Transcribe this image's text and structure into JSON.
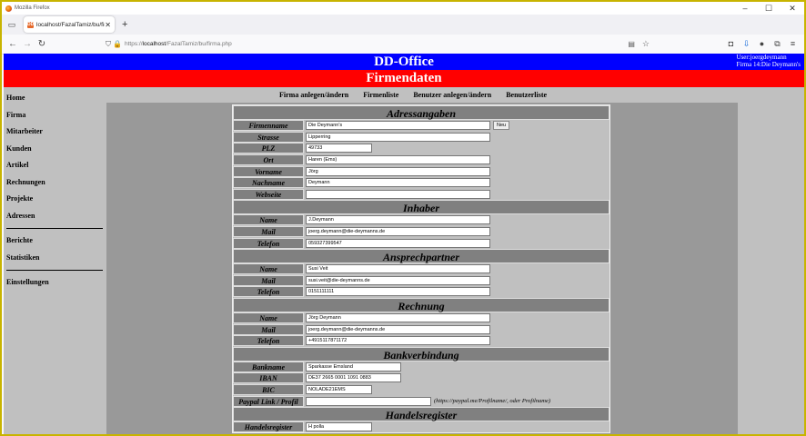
{
  "window": {
    "title": "Mozilla Firefox"
  },
  "tab": {
    "title": "localhost/FazalTamiz/bu/firma",
    "favicon": "DD"
  },
  "url": {
    "prefix": "https://",
    "host": "localhost",
    "path": "/FazalTamiz/bu/firma.php"
  },
  "header": {
    "app_title": "DD-Office",
    "user_line": "User:joergdeymann",
    "firm_line": "Firma 14:Die Deymann's",
    "page_title": "Firmendaten"
  },
  "sidebar": {
    "items": [
      "Home",
      "Firma",
      "Mitarbeiter",
      "Kunden",
      "Artikel",
      "Rechnungen",
      "Projekte",
      "Adressen"
    ],
    "items2": [
      "Berichte",
      "Statistiken"
    ],
    "items3": [
      "Einstellungen"
    ]
  },
  "topmenu": [
    "Firma anlegen/ändern",
    "Firmenliste",
    "Benutzer anlegen/ändern",
    "Benutzerliste"
  ],
  "form": {
    "adress": {
      "title": "Adressangaben",
      "firmenname_label": "Firmenname",
      "firmenname": "Die Deymann's",
      "neu_button": "Neu",
      "strasse_label": "Strasse",
      "strasse": "Lipperring",
      "plz_label": "PLZ",
      "plz": "49733",
      "ort_label": "Ort",
      "ort": "Haren (Ems)",
      "vorname_label": "Vorname",
      "vorname": "Jörg",
      "nachname_label": "Nachname",
      "nachname": "Deymann",
      "webseite_label": "Webseite",
      "webseite": ""
    },
    "inhaber": {
      "title": "Inhaber",
      "name_label": "Name",
      "name": "J.Deymann",
      "mail_label": "Mail",
      "mail": "joerg.deymann@die-deymanns.de",
      "telefon_label": "Telefon",
      "telefon": "059327399547"
    },
    "ansprech": {
      "title": "Ansprechpartner",
      "name_label": "Name",
      "name": "Susi Veit",
      "mail_label": "Mail",
      "mail": "susi.veit@die-deymanns.de",
      "telefon_label": "Telefon",
      "telefon": "0151111111"
    },
    "rechnung": {
      "title": "Rechnung",
      "name_label": "Name",
      "name": "Jörg Deymann",
      "mail_label": "Mail",
      "mail": "joerg.deymann@die-deymanns.de",
      "telefon_label": "Telefon",
      "telefon": "+4915117871172"
    },
    "bank": {
      "title": "Bankverbindung",
      "bankname_label": "Bankname",
      "bankname": "Sparkasse Emsland",
      "iban_label": "IBAN",
      "iban": "DE37 2665 0001 1091 0883",
      "bic_label": "BIC",
      "bic": "NOLADE21EMS",
      "paypal_label": "Paypal Link / Profil",
      "paypal": "",
      "paypal_hint": "(https://paypal.me/Profilname/, oder Profilname)"
    },
    "handel": {
      "title": "Handelsregister",
      "label": "Handelsregister",
      "value": "H polla"
    }
  }
}
